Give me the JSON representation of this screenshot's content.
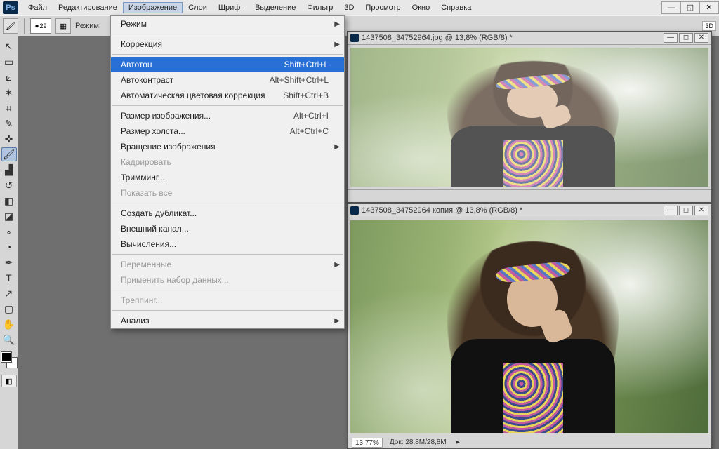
{
  "app": {
    "logo_text": "Ps"
  },
  "menubar": {
    "items": [
      "Файл",
      "Редактирование",
      "Изображение",
      "Слои",
      "Шрифт",
      "Выделение",
      "Фильтр",
      "3D",
      "Просмотр",
      "Окно",
      "Справка"
    ],
    "open_index": 2
  },
  "optionbar": {
    "brush_size": "29",
    "mode_label": "Режим:",
    "right_label": "3D"
  },
  "tools": {
    "items": [
      {
        "name": "move-tool",
        "glyph": "↖"
      },
      {
        "name": "marquee-tool",
        "glyph": "▭"
      },
      {
        "name": "lasso-tool",
        "glyph": "⟀"
      },
      {
        "name": "quick-select-tool",
        "glyph": "✶"
      },
      {
        "name": "crop-tool",
        "glyph": "⌗"
      },
      {
        "name": "eyedropper-tool",
        "glyph": "✎"
      },
      {
        "name": "healing-brush-tool",
        "glyph": "✜"
      },
      {
        "name": "brush-tool",
        "glyph": "🖌",
        "active": true
      },
      {
        "name": "clone-stamp-tool",
        "glyph": "▟"
      },
      {
        "name": "history-brush-tool",
        "glyph": "↺"
      },
      {
        "name": "eraser-tool",
        "glyph": "◧"
      },
      {
        "name": "gradient-tool",
        "glyph": "◪"
      },
      {
        "name": "blur-tool",
        "glyph": "∘"
      },
      {
        "name": "dodge-tool",
        "glyph": "◔"
      },
      {
        "name": "pen-tool",
        "glyph": "✒"
      },
      {
        "name": "type-tool",
        "glyph": "T"
      },
      {
        "name": "path-select-tool",
        "glyph": "↗"
      },
      {
        "name": "rectangle-tool",
        "glyph": "▢"
      },
      {
        "name": "hand-tool",
        "glyph": "✋"
      },
      {
        "name": "zoom-tool",
        "glyph": "🔍"
      }
    ]
  },
  "documents": {
    "a": {
      "title": "1437508_34752964.jpg @ 13,8% (RGB/8) *"
    },
    "b": {
      "title": "1437508_34752964 копия @ 13,8% (RGB/8) *",
      "zoom": "13,77%",
      "doc_label": "Док:",
      "doc_value": "28,8M/28,8M"
    }
  },
  "menu": {
    "items": [
      {
        "label": "Режим",
        "arrow": true
      },
      {
        "sep": true
      },
      {
        "label": "Коррекция",
        "arrow": true
      },
      {
        "sep": true
      },
      {
        "label": "Автотон",
        "shortcut": "Shift+Ctrl+L",
        "hl": true
      },
      {
        "label": "Автоконтраст",
        "shortcut": "Alt+Shift+Ctrl+L"
      },
      {
        "label": "Автоматическая цветовая коррекция",
        "shortcut": "Shift+Ctrl+B"
      },
      {
        "sep": true
      },
      {
        "label": "Размер изображения...",
        "shortcut": "Alt+Ctrl+I"
      },
      {
        "label": "Размер холста...",
        "shortcut": "Alt+Ctrl+C"
      },
      {
        "label": "Вращение изображения",
        "arrow": true
      },
      {
        "label": "Кадрировать",
        "disabled": true
      },
      {
        "label": "Тримминг..."
      },
      {
        "label": "Показать все",
        "disabled": true
      },
      {
        "sep": true
      },
      {
        "label": "Создать дубликат..."
      },
      {
        "label": "Внешний канал..."
      },
      {
        "label": "Вычисления..."
      },
      {
        "sep": true
      },
      {
        "label": "Переменные",
        "arrow": true,
        "disabled": true
      },
      {
        "label": "Применить набор данных...",
        "disabled": true
      },
      {
        "sep": true
      },
      {
        "label": "Треппинг...",
        "disabled": true
      },
      {
        "sep": true
      },
      {
        "label": "Анализ",
        "arrow": true
      }
    ]
  }
}
